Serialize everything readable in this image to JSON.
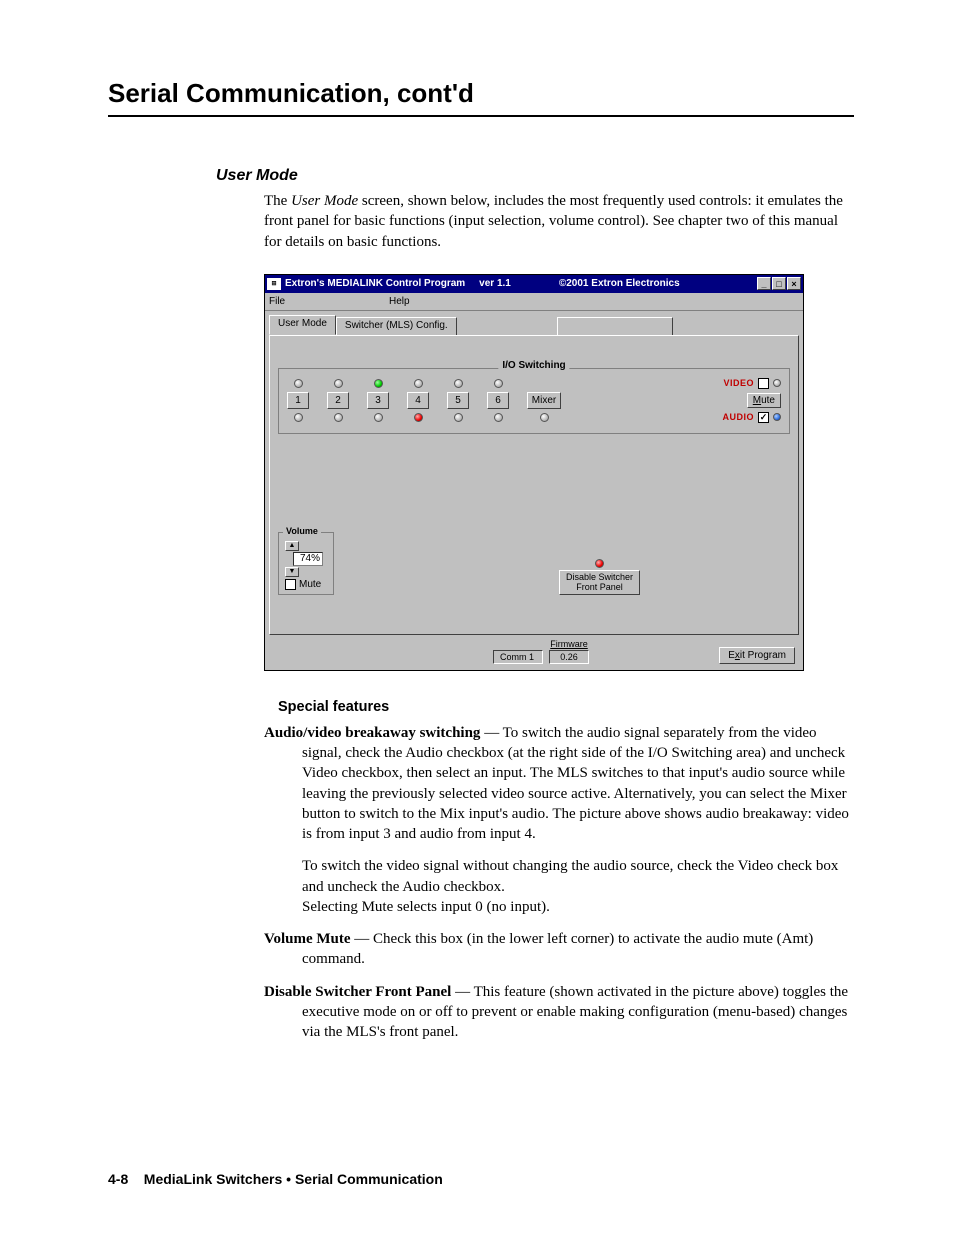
{
  "header": {
    "title": "Serial Communication, cont'd"
  },
  "section": {
    "heading": "User Mode",
    "intro_pre": "The ",
    "intro_em": "User Mode",
    "intro_post": " screen, shown below, includes the most frequently used controls: it emulates the front panel for basic functions (input selection, volume control).  See chapter two of this manual for details on basic functions."
  },
  "app": {
    "titlebar": {
      "name": "Extron's MEDIALINK Control Program",
      "version": "ver 1.1",
      "copyright": "©2001 Extron Electronics"
    },
    "menubar": {
      "file": "File",
      "help": "Help"
    },
    "tabs": {
      "user_mode": "User Mode",
      "switcher_config": "Switcher (MLS) Config."
    },
    "io": {
      "legend": "I/O Switching",
      "buttons": [
        "1",
        "2",
        "3",
        "4",
        "5",
        "6"
      ],
      "mixer": "Mixer",
      "video_selected_index": 2,
      "audio_selected_index": 3,
      "video_label": "VIDEO",
      "audio_label": "AUDIO",
      "mute_label": "Mute",
      "video_checked": false,
      "audio_checked": true
    },
    "volume": {
      "legend": "Volume",
      "value": "74%",
      "mute_label": "Mute",
      "mute_checked": false
    },
    "disable": {
      "line1": "Disable Switcher",
      "line2": "Front Panel",
      "led_on": true
    },
    "footer": {
      "comm": "Comm 1",
      "firmware_label": "Firmware",
      "firmware_value": "0.26",
      "exit_pre": "E",
      "exit_ul": "x",
      "exit_post": "it Program"
    }
  },
  "special": {
    "heading": "Special features",
    "features": [
      {
        "title": "Audio/video breakaway switching",
        "body": " — To switch the audio signal separately from the video signal, check the Audio checkbox (at the right side of the I/O Switching area) and uncheck Video checkbox, then select an input.  The MLS switches to that input's audio source while leaving the previously selected video source active.  Alternatively, you can select the Mixer button to switch to the Mix input's audio.  The picture above shows audio breakaway: video is from input 3 and audio from input 4.",
        "sub": "To switch the video signal without changing the audio source, check the Video check box and uncheck the Audio checkbox.\nSelecting Mute selects input 0 (no input)."
      },
      {
        "title": "Volume Mute",
        "body": " — Check this box (in the lower left corner) to activate the audio mute (Amt) command."
      },
      {
        "title": "Disable Switcher Front Panel",
        "body": " — This feature (shown activated in the picture above) toggles the executive mode on or off to prevent or enable making configuration (menu-based) changes via the MLS's front panel."
      }
    ]
  },
  "footer": {
    "page": "4-8",
    "text": "MediaLink Switchers • Serial Communication"
  }
}
